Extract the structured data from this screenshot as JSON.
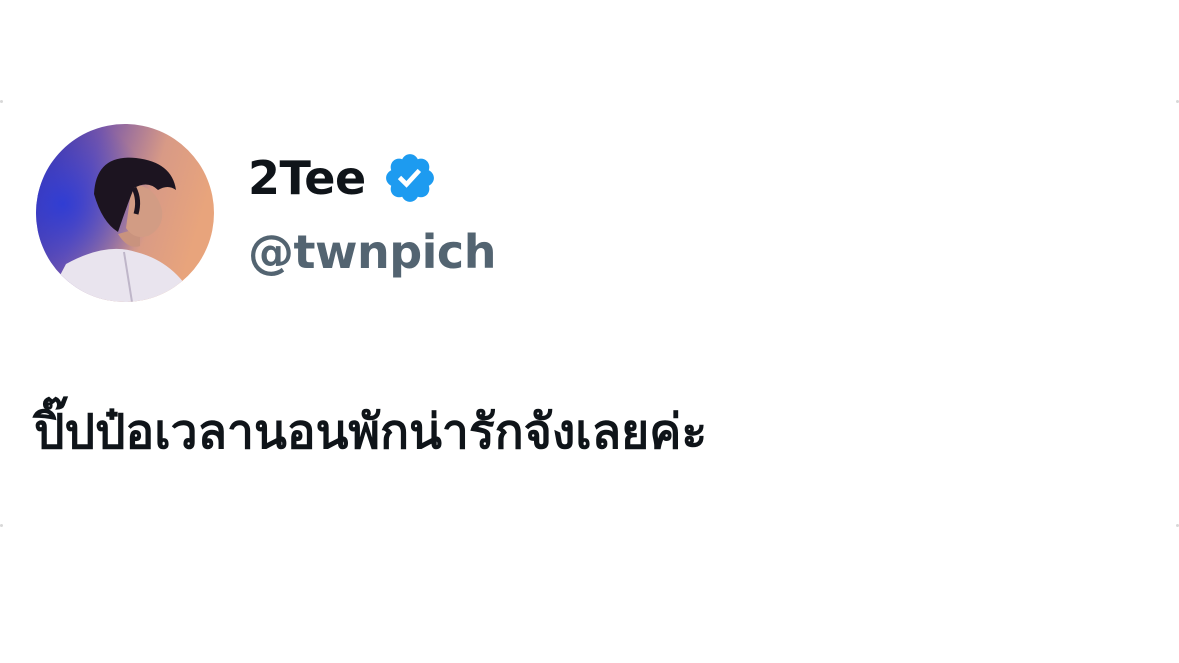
{
  "tweet": {
    "display_name": "2Tee",
    "username": "@twnpich",
    "verified": true,
    "text": "ปิ๊ปป๋อเวลานอนพักน่ารักจังเลยค่ะ"
  },
  "colors": {
    "name_text": "#0f1419",
    "username_text": "#536471",
    "verified_badge": "#1d9bf0",
    "background": "#ffffff"
  },
  "icons": {
    "verified": "verified-badge-icon",
    "avatar": "profile-avatar"
  }
}
